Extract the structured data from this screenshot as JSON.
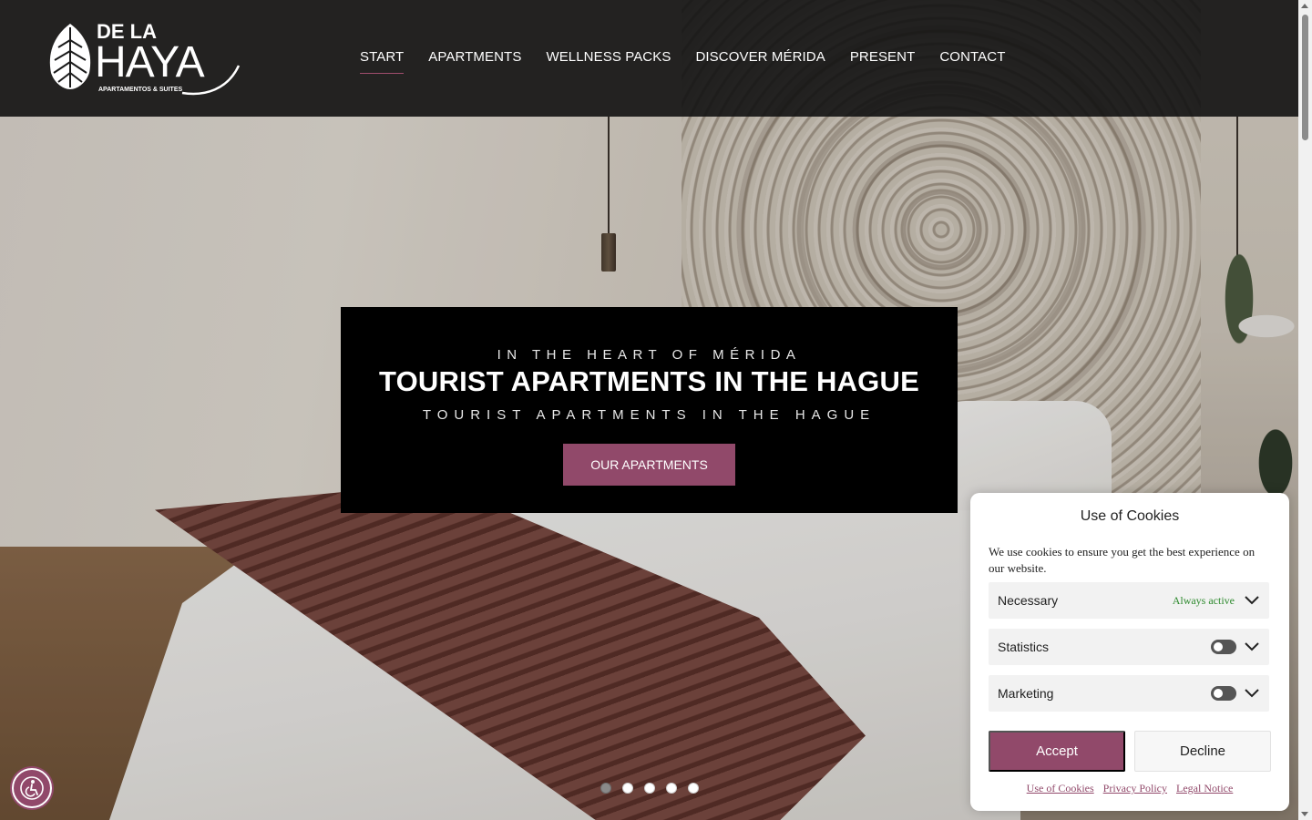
{
  "brand": {
    "logo_top": "DE LA",
    "logo_main": "HAYA",
    "logo_sub": "APARTAMENTOS & SUITES",
    "accent_color": "#91496a"
  },
  "nav": {
    "items": [
      {
        "label": "START",
        "active": true
      },
      {
        "label": "APARTMENTS",
        "active": false
      },
      {
        "label": "WELLNESS PACKS",
        "active": false
      },
      {
        "label": "DISCOVER MÉRIDA",
        "active": false
      },
      {
        "label": "PRESENT",
        "active": false
      },
      {
        "label": "CONTACT",
        "active": false
      }
    ]
  },
  "hero": {
    "pretitle": "IN THE HEART OF MÉRIDA",
    "title": "TOURIST APARTMENTS IN THE HAGUE",
    "subtitle": "TOURIST APARTMENTS IN THE HAGUE",
    "cta_label": "OUR APARTMENTS",
    "slides_total": 5,
    "active_slide": 1
  },
  "cookies": {
    "title": "Use of Cookies",
    "description": "We use cookies to ensure you get the best experience on our website.",
    "categories": [
      {
        "label": "Necessary",
        "status": "Always active"
      },
      {
        "label": "Statistics",
        "enabled": false
      },
      {
        "label": "Marketing",
        "enabled": false
      }
    ],
    "accept_label": "Accept",
    "decline_label": "Decline",
    "links": [
      "Use of Cookies",
      "Privacy Policy",
      "Legal Notice"
    ]
  },
  "icons": {
    "accessibility": "accessibility-icon",
    "chevron": "chevron-down-icon",
    "logo_leaf": "leaf-icon"
  }
}
